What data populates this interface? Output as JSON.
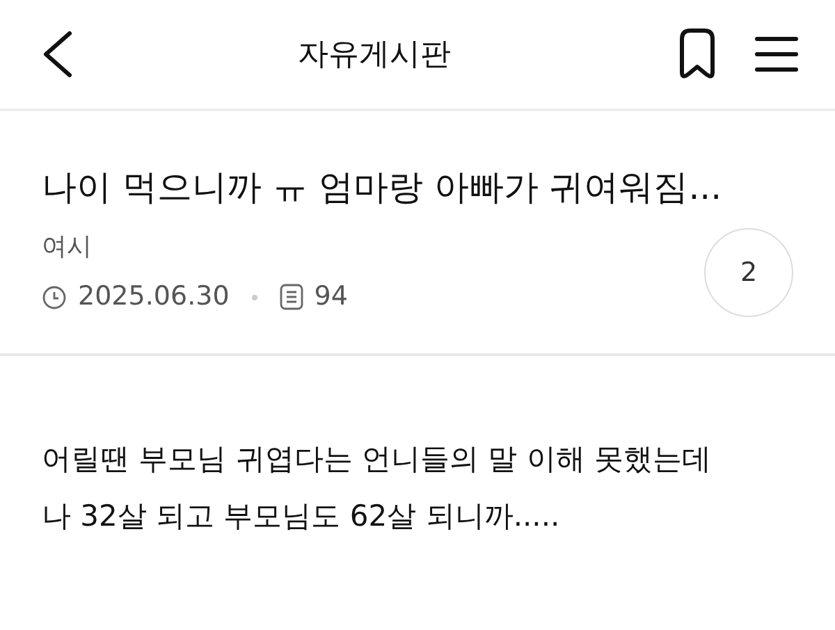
{
  "header": {
    "title": "자유게시판"
  },
  "post": {
    "title": "나이 먹으니까 ㅠ 엄마랑 아빠가 귀여워짐...",
    "author": "여시",
    "date": "2025.06.30",
    "views": "94",
    "comments": "2"
  },
  "body": [
    "어릴땐 부모님 귀엽다는 언니들의 말 이해 못했는데",
    "나 32살 되고 부모님도 62살 되니까....."
  ]
}
